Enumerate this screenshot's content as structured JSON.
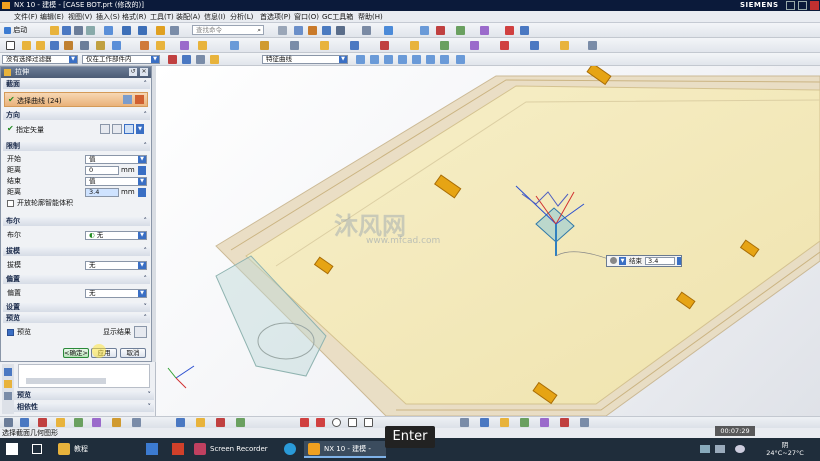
{
  "window": {
    "title": "NX 10 - 建模 - [CASE BOT.prt  (修改的)]",
    "brand": "SIEMENS"
  },
  "menu": [
    "文件(F)",
    "编辑(E)",
    "视图(V)",
    "插入(S)",
    "格式(R)",
    "工具(T)",
    "装配(A)",
    "信息(I)",
    "分析(L)",
    "首选项(P)",
    "窗口(O)",
    "GC工具箱",
    "帮助(H)"
  ],
  "toolbar": {
    "start_label": "启动",
    "search_placeholder": "查找命令"
  },
  "selection_bar": {
    "filter": "没有选择过滤器",
    "scope": "仅在工作部件内",
    "curve_rule": "特征曲线"
  },
  "dialog": {
    "title": "拉伸",
    "sections": {
      "section": "截面",
      "direction": "方向",
      "limits": "限制",
      "boolean": "布尔",
      "draft": "拔模",
      "offset": "偏置",
      "settings": "设置",
      "preview": "预览"
    },
    "select_curve": "选择曲线 (24)",
    "specify_vector": "指定矢量",
    "start_label": "开始",
    "start_value": "值",
    "distance_label": "距离",
    "start_distance": "0",
    "unit": "mm",
    "end_label": "结束",
    "end_value": "值",
    "end_distance": "3.4",
    "open_profile": "开放轮廓智能体积",
    "boolean_label": "布尔",
    "boolean_value": "无",
    "draft_label": "拔模",
    "draft_value": "无",
    "offset_label": "偏置",
    "offset_value": "无",
    "preview_label": "预览",
    "show_result": "显示结果",
    "ok": "<确定>",
    "apply": "应用",
    "cancel": "取消"
  },
  "nav_panel": {
    "preview": "预览",
    "dependencies": "相依性"
  },
  "viewport": {
    "watermark_cn": "沐风网",
    "watermark_url": "www.mfcad.com",
    "end_input_label": "结束",
    "end_input_value": "3.4"
  },
  "statusbar": {
    "text": "选择截面几何图形"
  },
  "overlay": {
    "key": "Enter",
    "timer": "00:07:29"
  },
  "taskbar": {
    "items": [
      "教程",
      "Screen Recorder",
      "NX 10 - 建模 - [CA..."
    ],
    "weather": "阴",
    "temperature": "24°C~27°C"
  },
  "colors": {
    "title_bg": "#0b1a3a",
    "model_fill": "#f2e7b8",
    "boss_color": "#e6a414",
    "taskbar_bg": "#1f2d3b"
  }
}
